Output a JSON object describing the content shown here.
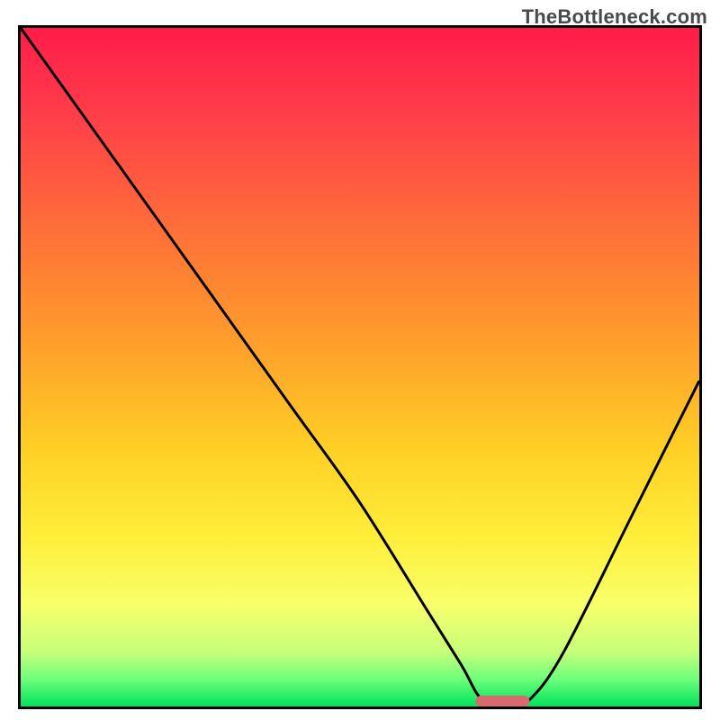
{
  "watermark": "TheBottleneck.com",
  "chart_data": {
    "type": "line",
    "title": "",
    "xlabel": "",
    "ylabel": "",
    "xlim": [
      0,
      100
    ],
    "ylim": [
      0,
      100
    ],
    "grid": false,
    "legend": false,
    "series": [
      {
        "name": "bottleneck-curve",
        "x": [
          0,
          10,
          20,
          25,
          30,
          40,
          50,
          60,
          65,
          68,
          72,
          75,
          80,
          90,
          100
        ],
        "y": [
          100,
          86,
          72,
          65,
          58,
          44,
          30,
          14,
          6,
          1,
          0,
          1,
          8,
          28,
          48
        ]
      }
    ],
    "marker": {
      "name": "optimal-range",
      "x_start": 67,
      "x_end": 75,
      "y": 0.8,
      "color": "#d86a6f"
    }
  }
}
